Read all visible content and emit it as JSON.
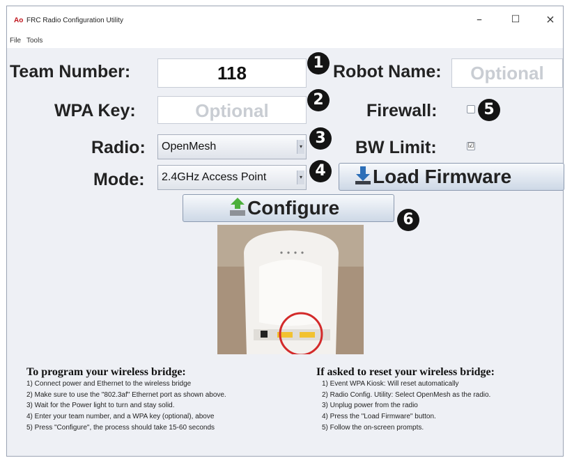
{
  "window": {
    "logo_text": "Ao",
    "title": "FRC Radio Configuration Utility",
    "controls": {
      "minimize": "–",
      "maximize": "☐",
      "close": "×"
    }
  },
  "menu": {
    "items": [
      "File",
      "Tools"
    ]
  },
  "form": {
    "team_number_label": "Team Number:",
    "team_number_value": "118",
    "robot_name_label": "Robot Name:",
    "robot_name_placeholder": "Optional",
    "wpa_key_label": "WPA Key:",
    "wpa_key_placeholder": "Optional",
    "firewall_label": "Firewall:",
    "firewall_checked": false,
    "radio_label": "Radio:",
    "radio_value": "OpenMesh",
    "bw_limit_label": "BW Limit:",
    "bw_limit_checked": true,
    "bw_limit_mark": "☑",
    "mode_label": "Mode:",
    "mode_value": "2.4GHz Access Point"
  },
  "buttons": {
    "load_firmware": "Load Firmware",
    "configure": "Configure"
  },
  "badges": [
    "1",
    "2",
    "3",
    "4",
    "5",
    "6"
  ],
  "instructions": {
    "program_title": "To program your wireless bridge:",
    "program_steps": [
      "1) Connect power and Ethernet to the wireless bridge",
      "2) Make sure to use the \"802.3af\" Ethernet port as shown above.",
      "3) Wait for the Power light to turn and stay solid.",
      "4) Enter your team number, and a WPA key (optional), above",
      "5) Press \"Configure\", the process should take 15-60 seconds"
    ],
    "reset_title": "If asked to reset your wireless bridge:",
    "reset_steps": [
      "1) Event WPA Kiosk: Will reset automatically",
      "2) Radio Config. Utility: Select OpenMesh as the radio.",
      "3) Unplug power from the radio",
      "4) Press the \"Load Firmware\" button.",
      "5) Follow the on-screen prompts."
    ]
  },
  "colors": {
    "window_bg": "#eef0f5",
    "badge_bg": "#141414",
    "highlight_circle": "#d32a2a",
    "port_yellow": "#f2c230"
  }
}
